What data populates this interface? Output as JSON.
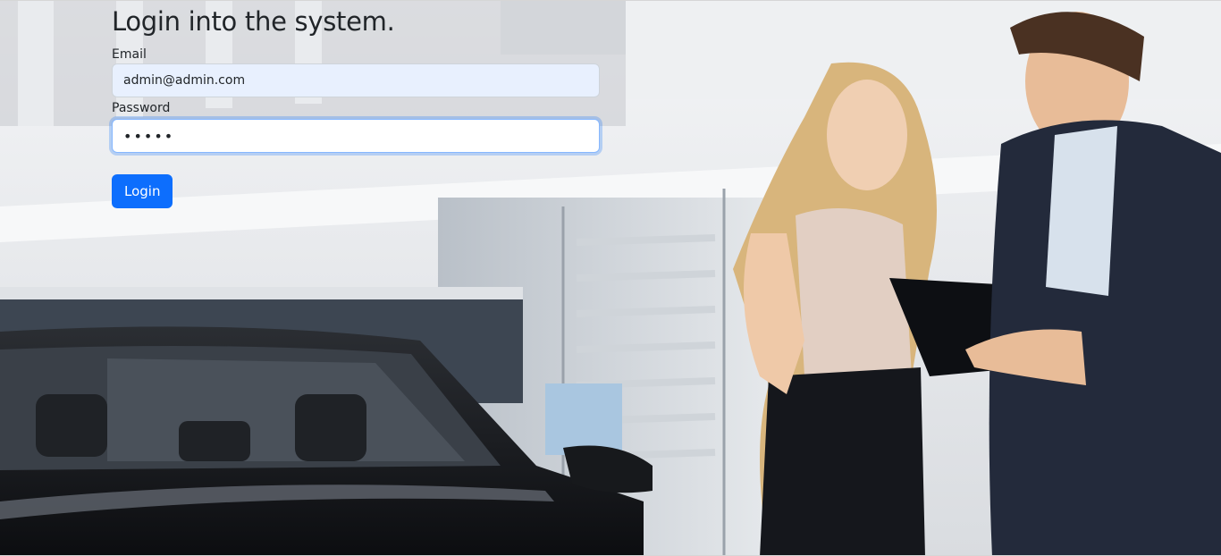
{
  "login": {
    "title": "Login into the system.",
    "email_label": "Email",
    "email_value": "admin@admin.com",
    "password_label": "Password",
    "password_value": "•••••",
    "login_button": "Login"
  },
  "background": {
    "description_icon": "dealership-photo"
  },
  "colors": {
    "primary": "#0d6efd",
    "autofill": "#e8f0fe",
    "text": "#212529"
  }
}
